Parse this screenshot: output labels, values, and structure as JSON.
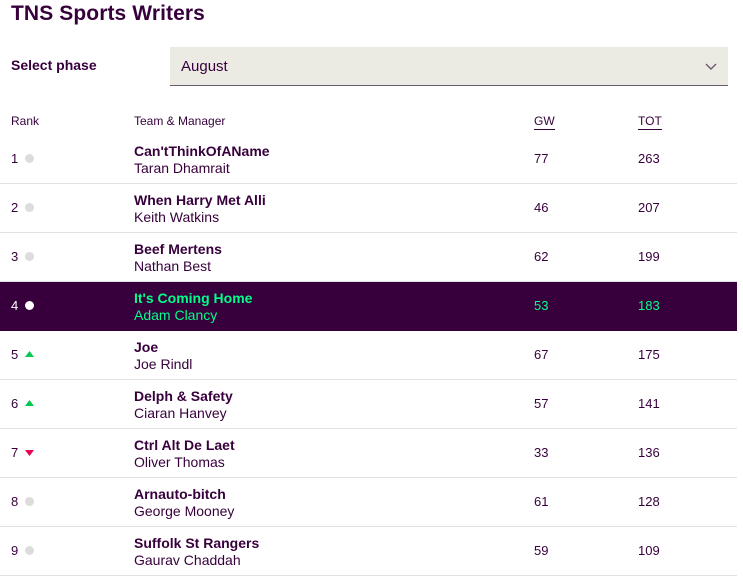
{
  "page": {
    "title": "TNS Sports Writers"
  },
  "phase": {
    "label": "Select phase",
    "selected": "August"
  },
  "table": {
    "headers": {
      "rank": "Rank",
      "team": "Team & Manager",
      "gw": "GW",
      "tot": "TOT"
    },
    "rows": [
      {
        "rank": "1",
        "movement": "same",
        "team": "Can'tThinkOfAName",
        "manager": "Taran Dhamrait",
        "gw": "77",
        "tot": "263"
      },
      {
        "rank": "2",
        "movement": "same",
        "team": "When Harry Met Alli",
        "manager": "Keith Watkins",
        "gw": "46",
        "tot": "207"
      },
      {
        "rank": "3",
        "movement": "same",
        "team": "Beef Mertens",
        "manager": "Nathan Best",
        "gw": "62",
        "tot": "199"
      },
      {
        "rank": "4",
        "movement": "same",
        "team": "It's Coming Home",
        "manager": "Adam Clancy",
        "gw": "53",
        "tot": "183",
        "highlighted": true
      },
      {
        "rank": "5",
        "movement": "up",
        "team": "Joe",
        "manager": "Joe Rindl",
        "gw": "67",
        "tot": "175"
      },
      {
        "rank": "6",
        "movement": "up",
        "team": "Delph & Safety",
        "manager": "Ciaran Hanvey",
        "gw": "57",
        "tot": "141"
      },
      {
        "rank": "7",
        "movement": "down",
        "team": "Ctrl Alt De Laet",
        "manager": "Oliver Thomas",
        "gw": "33",
        "tot": "136"
      },
      {
        "rank": "8",
        "movement": "same",
        "team": "Arnauto-bitch",
        "manager": "George Mooney",
        "gw": "61",
        "tot": "128"
      },
      {
        "rank": "9",
        "movement": "same",
        "team": "Suffolk St Rangers",
        "manager": "Gaurav Chaddah",
        "gw": "59",
        "tot": "109"
      }
    ]
  },
  "colors": {
    "primary": "#37003c",
    "highlight_text": "#00ff87",
    "up": "#00c853",
    "down": "#e90052",
    "same": "#d9d9d9"
  }
}
